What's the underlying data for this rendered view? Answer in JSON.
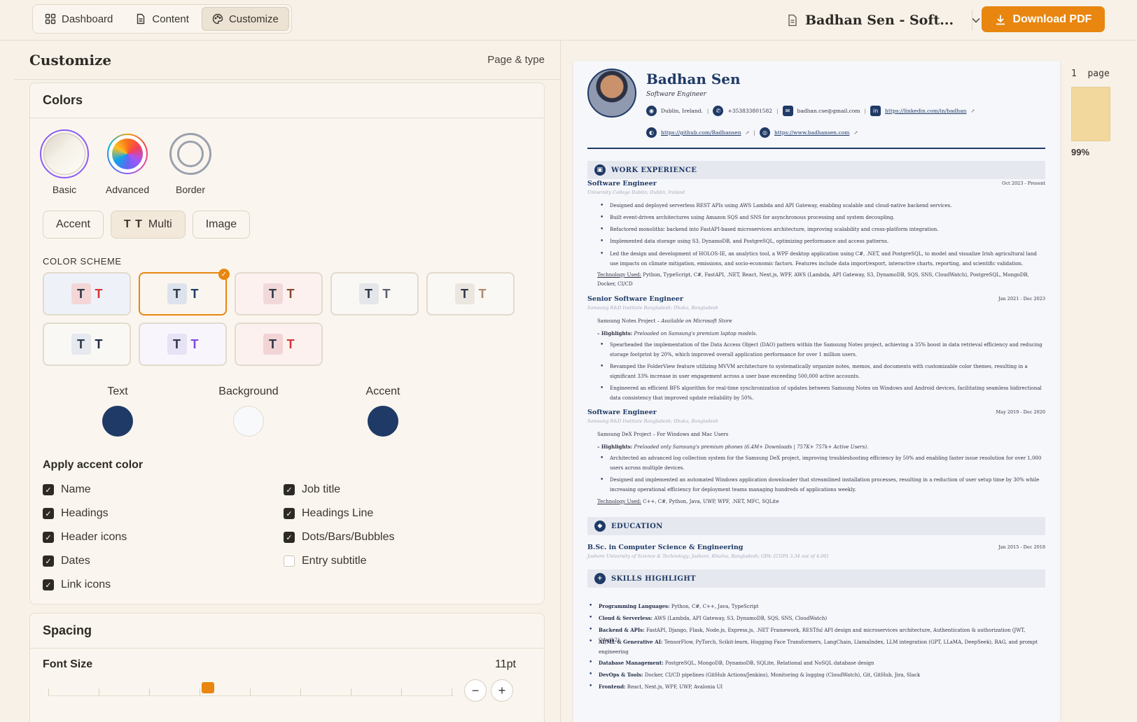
{
  "nav": {
    "tabs": [
      {
        "label": "Dashboard",
        "icon": "grid-icon"
      },
      {
        "label": "Content",
        "icon": "document-icon"
      },
      {
        "label": "Customize",
        "icon": "palette-icon"
      }
    ],
    "active_tab": "Customize",
    "document_name": "Badhan Sen - Soft...",
    "download_label": "Download PDF"
  },
  "colors": {
    "accent": "#e8860f",
    "navy": "#1f3a66",
    "page_bg": "#f7f1e8"
  },
  "customize": {
    "title": "Customize",
    "page_type_link": "Page & type",
    "colors_card": {
      "title": "Colors",
      "modes": [
        "Basic",
        "Advanced",
        "Border"
      ],
      "selected_mode": "Basic",
      "types": [
        "Accent",
        "Multi",
        "Image"
      ],
      "multi_prefix": "T T",
      "selected_type": "Multi",
      "scheme_label": "COLOR SCHEME",
      "scheme_glyph": "T",
      "schemes": [
        {
          "box_bg": "#f4d6d6",
          "text": "#2d3748",
          "accent": "#d63636",
          "card_bg": "#eef2f8"
        },
        {
          "box_bg": "#dde3ec",
          "text": "#2d3748",
          "accent": "#1f3a66",
          "card_bg": "#faf6ef",
          "selected": true
        },
        {
          "box_bg": "#f1d9d9",
          "text": "#2d3748",
          "accent": "#8a4a2f",
          "card_bg": "#fdf1f0"
        },
        {
          "box_bg": "#e4e6ea",
          "text": "#2d3748",
          "accent": "#5a6070",
          "card_bg": "#faf8f5"
        },
        {
          "box_bg": "#ebe6e0",
          "text": "#2d3748",
          "accent": "#b08a70",
          "card_bg": "#faf8f5"
        },
        {
          "box_bg": "#e6e9ee",
          "text": "#2d3748",
          "accent": "#1f2a44",
          "card_bg": "#faf8f5"
        },
        {
          "box_bg": "#e8e2f5",
          "text": "#2d3748",
          "accent": "#7c4ddb",
          "card_bg": "#f8f5fd"
        },
        {
          "box_bg": "#f2d4d4",
          "text": "#2d3748",
          "accent": "#d63636",
          "card_bg": "#fdf1f0"
        }
      ],
      "swatches": [
        {
          "label": "Text",
          "color": "#1f3a66"
        },
        {
          "label": "Background",
          "color": "#f8f9fb"
        },
        {
          "label": "Accent",
          "color": "#1f3a66"
        }
      ],
      "apply_title": "Apply accent color",
      "apply_options": [
        {
          "label": "Name",
          "checked": true
        },
        {
          "label": "Job title",
          "checked": true
        },
        {
          "label": "Headings",
          "checked": true
        },
        {
          "label": "Headings Line",
          "checked": true
        },
        {
          "label": "Header icons",
          "checked": true
        },
        {
          "label": "Dots/Bars/Bubbles",
          "checked": true
        },
        {
          "label": "Dates",
          "checked": true
        },
        {
          "label": "Entry subtitle",
          "checked": false
        },
        {
          "label": "Link icons",
          "checked": true
        }
      ]
    },
    "spacing_card": {
      "title": "Spacing",
      "font_size_label": "Font Size",
      "font_size_value": "11pt",
      "minus": "−",
      "plus": "+"
    }
  },
  "resume": {
    "name": "Badhan Sen",
    "title": "Software Engineer",
    "contacts": [
      {
        "text": "Dublin, Ireland.",
        "icon": "location-icon",
        "link": false
      },
      {
        "text": "+353833801582",
        "icon": "phone-icon",
        "link": false
      },
      {
        "text": "badhan.cse@gmail.com",
        "icon": "mail-icon",
        "link": false
      },
      {
        "text": "https://linkedin.com/in/badhan",
        "icon": "linkedin-icon",
        "link": true
      },
      {
        "text": "https://github.com/Badhansen",
        "icon": "github-icon",
        "link": true
      },
      {
        "text": "https://www.badhansen.com",
        "icon": "globe-icon",
        "link": true
      }
    ],
    "sections": {
      "work": "WORK EXPERIENCE",
      "education": "EDUCATION",
      "skills": "SKILLS HIGHLIGHT"
    },
    "jobs": [
      {
        "role": "Software Engineer",
        "date": "Oct 2023 - Present",
        "org": "University College Dublin; Dublin, Ireland",
        "bullets": [
          "Designed and deployed serverless REST APIs using AWS Lambda and API Gateway, enabling scalable and cloud-native backend services.",
          "Built event-driven architectures using Amazon SQS and SNS for asynchronous processing and system decoupling.",
          "Refactored monolithic backend into FastAPI-based microservices architecture, improving scalability and cross-platform integration.",
          "Implemented data storage using S3, DynamoDB, and PostgreSQL, optimizing performance and access patterns.",
          "Led the design and development of HOLOS-IE, an analytics tool, a WPF desktop application using C#, .NET, and PostgreSQL, to model and visualize Irish agricultural land use impacts on climate mitigation, emissions, and socio-economic factors. Features include data import/export, interactive charts, reporting, and scientific validation."
        ],
        "tech_label": "Technology Used:",
        "tech": "Python, TypeScript, C#, FastAPI, .NET, React, Next.js, WPF, AWS (Lambda, API Gateway, S3, DynamoDB, SQS, SNS, CloudWatch), PostgreSQL, MongoDB, Docker, CI/CD"
      },
      {
        "role": "Senior Software Engineer",
        "date": "Jan 2021 - Dec 2023",
        "org": "Samsung R&D Institute Bangladesh; Dhaka, Bangladesh",
        "project": "Samsung Notes Project –",
        "project_note": "Available on Microsoft Store",
        "highlights_label": "– Highlights:",
        "highlights": "Preloaded on Samsung's premium laptop models.",
        "bullets": [
          "Spearheaded the implementation of the Data Access Object (DAO) pattern within the Samsung Notes project, achieving a 35% boost in data retrieval efficiency and reducing storage footprint by 20%, which improved overall application performance for over 1 million users.",
          "Revamped the FolderView feature utilizing MVVM architecture to systematically organize notes, memos, and documents with customizable color themes, resulting in a significant 33% increase in user engagement across a user base exceeding 500,000 active accounts.",
          "Engineered an efficient BFS algorithm for real-time synchronization of updates between Samsung Notes on Windows and Android devices, facilitating seamless bidirectional data consistency that improved update reliability by 50%."
        ]
      },
      {
        "role": "Software Engineer",
        "date": "May 2019 - Dec 2020",
        "org": "Samsung R&D Institute Bangladesh; Dhaka, Bangladesh",
        "project": "Samsung DeX Project –",
        "project_note": "For Windows and Mac Users",
        "highlights_label": "– Highlights:",
        "highlights": "Preloaded only Samsung's premium phones (6.4M+ Downloads | 757K+ 757k+ Active Users).",
        "bullets": [
          "Architected an advanced log collection system for the Samsung DeX project, improving troubleshooting efficiency by 50% and enabling faster issue resolution for over 1,000 users across multiple devices.",
          "Designed and implemented an automated Windows application downloader that streamlined installation processes, resulting in a reduction of user setup time by 30% while increasing operational efficiency for deployment teams managing hundreds of applications weekly."
        ],
        "tech_label": "Technology Used:",
        "tech": "C++, C#, Python, Java, UWP, WPF, .NET, MFC, SQLite"
      }
    ],
    "education": {
      "degree": "B.Sc. in Computer Science & Engineering",
      "date": "Jan 2015 - Dec 2018",
      "org": "Jashore University of Science & Technology; Jashore, Khulna, Bangladesh; GPA: [CGPA 3.34 out of 4.00]"
    },
    "skills": [
      {
        "label": "Programming Languages:",
        "text": "Python, C#, C++, Java, TypeScript"
      },
      {
        "label": "Cloud & Serverless:",
        "text": "AWS (Lambda, API Gateway, S3, DynamoDB, SQS, SNS, CloudWatch)"
      },
      {
        "label": "Backend & APIs:",
        "text": "FastAPI, Django, Flask, Node.js, Express.js, .NET Framework, RESTful API design and microservices architecture, Authentication & authorization (JWT, OAuth2)"
      },
      {
        "label": "AI/ML & Generative AI:",
        "text": "TensorFlow, PyTorch, Scikit-learn, Hugging Face Transformers, LangChain, LlamaIndex, LLM integration (GPT, LLaMA, DeepSeek), RAG, and prompt engineering"
      },
      {
        "label": "Database Management:",
        "text": "PostgreSQL, MongoDB, DynamoDB, SQLite, Relational and NoSQL database design"
      },
      {
        "label": "DevOps & Tools:",
        "text": "Docker, CI/CD pipelines (GitHub Actions/Jenkins), Monitoring & logging (CloudWatch), Git, GitHub, Jira, Slack"
      },
      {
        "label": "Frontend:",
        "text": "React, Next.js, WPF, UWP, Avalonia UI"
      }
    ]
  },
  "pager": {
    "count": "1",
    "label": "page",
    "zoom": "99%"
  }
}
